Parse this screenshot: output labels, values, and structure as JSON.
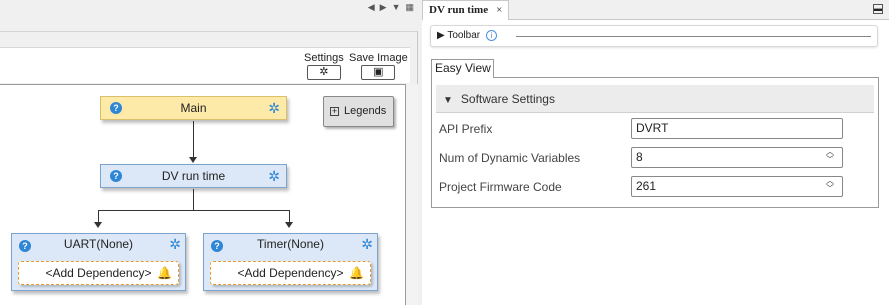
{
  "left_toolbar": {
    "settings_label": "Settings",
    "save_image_label": "Save Image"
  },
  "canvas": {
    "main_node": "Main",
    "dv_node": "DV run time",
    "uart_card": {
      "title": "UART(None)",
      "dependency": "<Add Dependency>"
    },
    "timer_card": {
      "title": "Timer(None)",
      "dependency": "<Add Dependency>"
    },
    "legends_label": "Legends"
  },
  "right_panel": {
    "tab_title": "DV run time",
    "tab_close": "×",
    "toolbar_label": "Toolbar",
    "easy_view_tab": "Easy View",
    "section_title": "Software Settings",
    "fields": [
      {
        "label": "API Prefix",
        "value": "DVRT"
      },
      {
        "label": "Num of Dynamic Variables",
        "value": "8"
      },
      {
        "label": "Project Firmware Code",
        "value": "261"
      }
    ]
  },
  "colors": {
    "main_node_fill": "#fde9a8",
    "module_fill": "#dce8f7",
    "icon_blue": "#2f86d6",
    "warning_orange": "#f39a1e"
  }
}
